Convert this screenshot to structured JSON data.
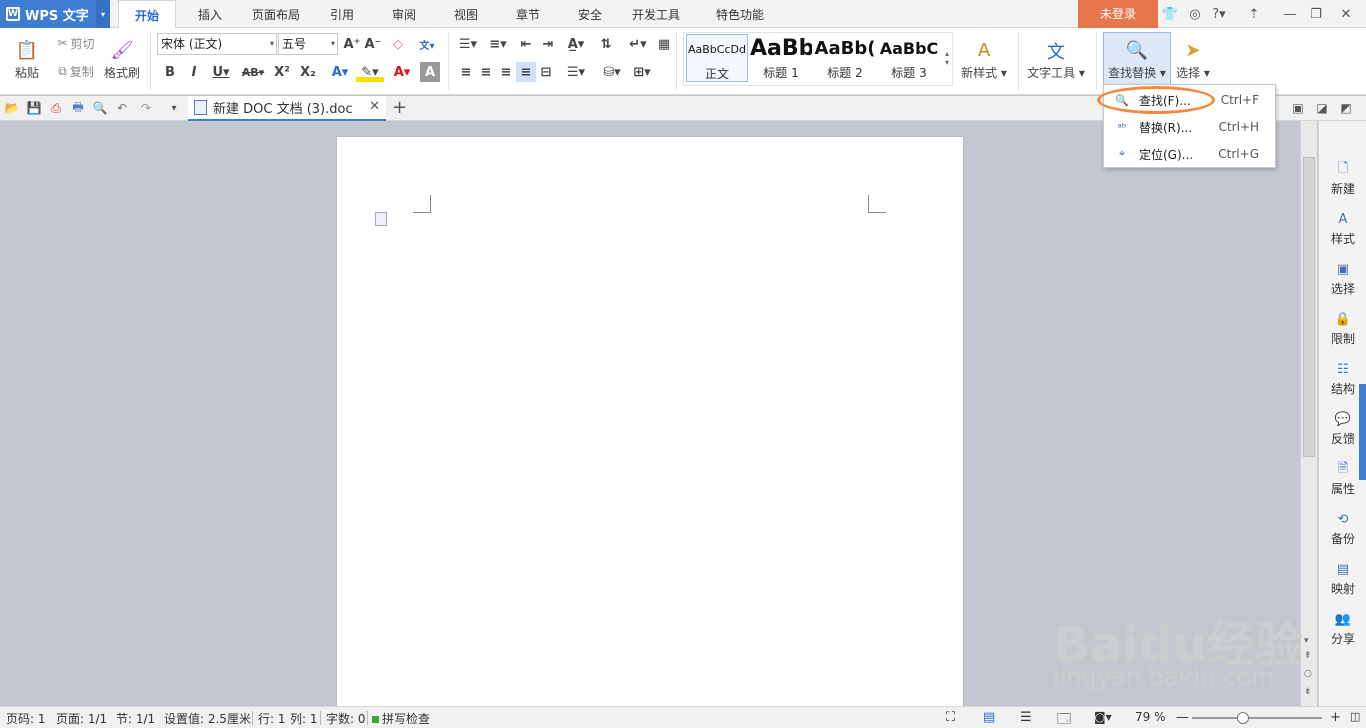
{
  "app": {
    "name": "WPS 文字",
    "login": "未登录"
  },
  "menu_tabs": [
    "开始",
    "插入",
    "页面布局",
    "引用",
    "审阅",
    "视图",
    "章节",
    "安全",
    "开发工具",
    "特色功能"
  ],
  "clipboard": {
    "paste": "粘贴",
    "cut": "剪切",
    "copy": "复制",
    "format_painter": "格式刷"
  },
  "font": {
    "family": "宋体 (正文)",
    "size": "五号"
  },
  "styles": [
    {
      "preview": "AaBbCcDd",
      "name": "正文"
    },
    {
      "preview": "AaBb",
      "name": "标题 1"
    },
    {
      "preview": "AaBb(",
      "name": "标题 2"
    },
    {
      "preview": "AaBbC",
      "name": "标题 3"
    }
  ],
  "ribbon": {
    "new_style": "新样式",
    "text_tools": "文字工具",
    "find_replace": "查找替换",
    "select": "选择"
  },
  "document_tab": {
    "title": "新建 DOC 文档 (3).doc"
  },
  "find_menu": [
    {
      "label": "查找(F)...",
      "shortcut": "Ctrl+F",
      "icon": "find-icon"
    },
    {
      "label": "替换(R)...",
      "shortcut": "Ctrl+H",
      "icon": "replace-icon"
    },
    {
      "label": "定位(G)...",
      "shortcut": "Ctrl+G",
      "icon": "goto-icon"
    }
  ],
  "sidebar": [
    "新建",
    "样式",
    "选择",
    "限制",
    "结构",
    "反馈",
    "属性",
    "备份",
    "映射",
    "分享"
  ],
  "status": {
    "page_num": "页码: 1",
    "page": "页面: 1/1",
    "section": "节: 1/1",
    "setting": "设置值: 2.5厘米",
    "row": "行: 1",
    "col": "列: 1",
    "words": "字数: 0",
    "spell": "拼写检查",
    "zoom": "79 %"
  },
  "watermark": {
    "main": "Baidu经验",
    "sub": "jingyan.baidu.com"
  },
  "colors": {
    "accent": "#3f7dd3",
    "login_bg": "#e8764c",
    "highlight": "#f08a3c"
  }
}
